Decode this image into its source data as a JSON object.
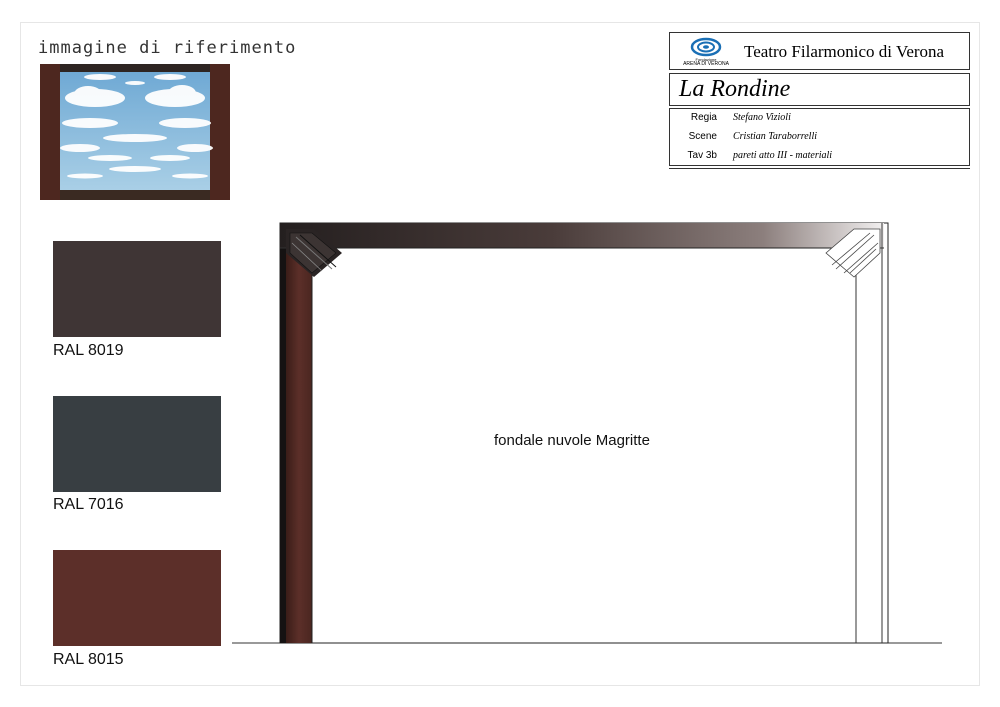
{
  "reference": {
    "title": "immagine di riferimento"
  },
  "swatches": [
    {
      "label": "RAL 8019",
      "color": "#3f3535"
    },
    {
      "label": "RAL 7016",
      "color": "#383e42"
    },
    {
      "label": "RAL 8015",
      "color": "#5c2f29"
    }
  ],
  "title_block": {
    "theatre": "Teatro Filarmonico di Verona",
    "logo_line1": "Fondazione",
    "logo_line2": "ARENA DI VERONA",
    "opera": "La Rondine",
    "rows": [
      {
        "label": "Regia",
        "value": "Stefano Vizioli"
      },
      {
        "label": "Scene",
        "value": "Cristian Taraborrelli"
      },
      {
        "label": "Tav 3b",
        "value": "pareti atto III - materiali"
      }
    ]
  },
  "drawing": {
    "backdrop_label": "fondale nuvole Magritte"
  },
  "colors": {
    "frame_dark": "#2b2626",
    "frame_brown": "#5c2f29",
    "sky": "#7fb3d9",
    "logo_blue": "#1a6fb5"
  }
}
